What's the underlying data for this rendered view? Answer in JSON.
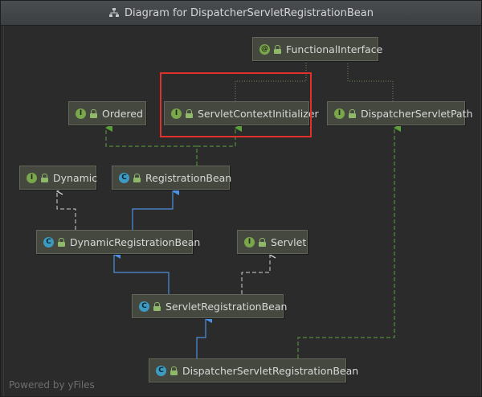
{
  "window": {
    "title": "Diagram for DispatcherServletRegistrationBean"
  },
  "footer": {
    "text": "Powered by yFiles"
  },
  "colors": {
    "implements_edge": "#5aa03c",
    "extends_edge": "#4d8fe0",
    "dependency_edge": "#d0d0d0",
    "highlight": "#e0312a"
  },
  "nodes": {
    "functional_interface": {
      "label": "FunctionalInterface",
      "kind": "annotation",
      "badge": "@",
      "icon": "annotation-icon"
    },
    "ordered": {
      "label": "Ordered",
      "kind": "interface",
      "badge": "I",
      "icon": "interface-icon"
    },
    "servlet_context_initializer": {
      "label": "ServletContextInitializer",
      "kind": "interface",
      "badge": "I",
      "icon": "interface-icon"
    },
    "dispatcher_servlet_path": {
      "label": "DispatcherServletPath",
      "kind": "interface",
      "badge": "I",
      "icon": "interface-icon"
    },
    "dynamic": {
      "label": "Dynamic",
      "kind": "interface",
      "badge": "I",
      "icon": "interface-icon"
    },
    "registration_bean": {
      "label": "RegistrationBean",
      "kind": "abstract-class",
      "badge": "C",
      "icon": "abstract-class-icon"
    },
    "dynamic_registration_bean": {
      "label": "DynamicRegistrationBean",
      "kind": "abstract-class",
      "badge": "C",
      "icon": "abstract-class-icon"
    },
    "servlet": {
      "label": "Servlet",
      "kind": "interface",
      "badge": "I",
      "icon": "interface-icon"
    },
    "servlet_registration_bean": {
      "label": "ServletRegistrationBean",
      "kind": "class",
      "badge": "C",
      "icon": "class-icon"
    },
    "dispatcher_servlet_registration_bean": {
      "label": "DispatcherServletRegistrationBean",
      "kind": "class",
      "badge": "C",
      "icon": "class-icon"
    }
  }
}
